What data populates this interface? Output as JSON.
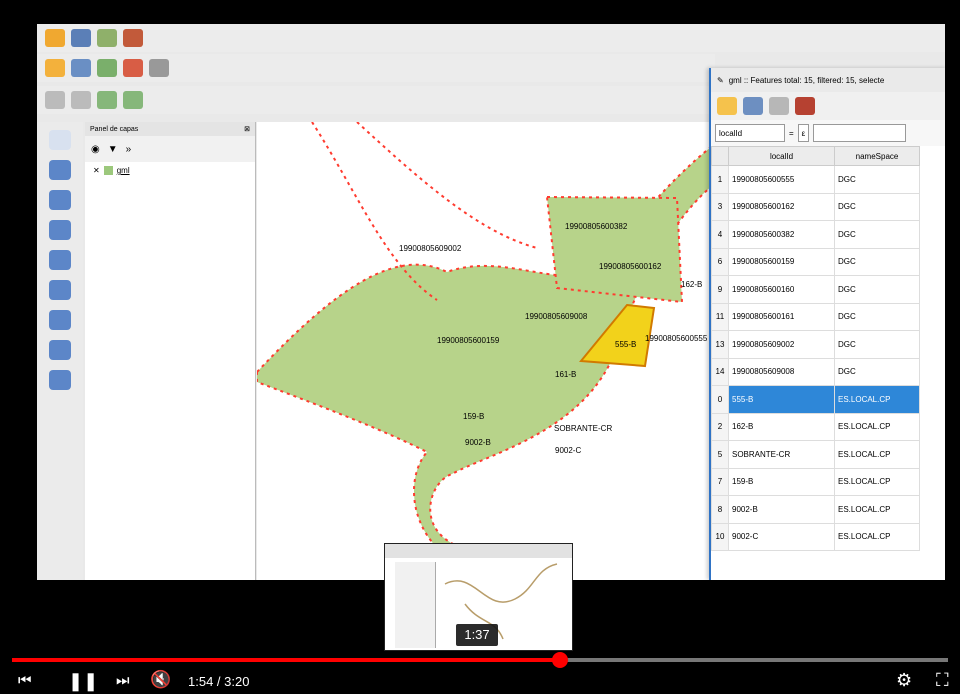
{
  "layers_panel": {
    "title": "Panel de capas",
    "layer_name": "gml"
  },
  "attribute_table": {
    "title": "gml :: Features total: 15, filtered: 15, selecte",
    "filter_field": "localId",
    "filter_expr": "ε",
    "columns": [
      "localId",
      "nameSpace"
    ],
    "rows": [
      {
        "num": "1",
        "localId": "19900805600555",
        "nameSpace": "DGC",
        "selected": false
      },
      {
        "num": "3",
        "localId": "19900805600162",
        "nameSpace": "DGC",
        "selected": false
      },
      {
        "num": "4",
        "localId": "19900805600382",
        "nameSpace": "DGC",
        "selected": false
      },
      {
        "num": "6",
        "localId": "19900805600159",
        "nameSpace": "DGC",
        "selected": false
      },
      {
        "num": "9",
        "localId": "19900805600160",
        "nameSpace": "DGC",
        "selected": false
      },
      {
        "num": "11",
        "localId": "19900805600161",
        "nameSpace": "DGC",
        "selected": false
      },
      {
        "num": "13",
        "localId": "19900805609002",
        "nameSpace": "DGC",
        "selected": false
      },
      {
        "num": "14",
        "localId": "19900805609008",
        "nameSpace": "DGC",
        "selected": false
      },
      {
        "num": "0",
        "localId": "555-B",
        "nameSpace": "ES.LOCAL.CP",
        "selected": true
      },
      {
        "num": "2",
        "localId": "162-B",
        "nameSpace": "ES.LOCAL.CP",
        "selected": false
      },
      {
        "num": "5",
        "localId": "SOBRANTE-CR",
        "nameSpace": "ES.LOCAL.CP",
        "selected": false
      },
      {
        "num": "7",
        "localId": "159-B",
        "nameSpace": "ES.LOCAL.CP",
        "selected": false
      },
      {
        "num": "8",
        "localId": "9002-B",
        "nameSpace": "ES.LOCAL.CP",
        "selected": false
      },
      {
        "num": "10",
        "localId": "9002-C",
        "nameSpace": "ES.LOCAL.CP",
        "selected": false
      }
    ]
  },
  "map_labels": [
    "19900805609002",
    "19900805600382",
    "19900805600162",
    "162-B",
    "19900805609008",
    "19900805600159",
    "555-B",
    "19900805600555",
    "161-B",
    "159-B",
    "SOBRANTE-CR",
    "9002-B",
    "9002-C"
  ],
  "player": {
    "time": "1:54 / 3:20",
    "preview_time": "1:37",
    "progress": 0.585
  },
  "colors": {
    "parcel_fill": "#b7d38a",
    "selected_fill": "#f2d21b",
    "vertex": "#ff3b2f",
    "progress": "#ff0000"
  }
}
